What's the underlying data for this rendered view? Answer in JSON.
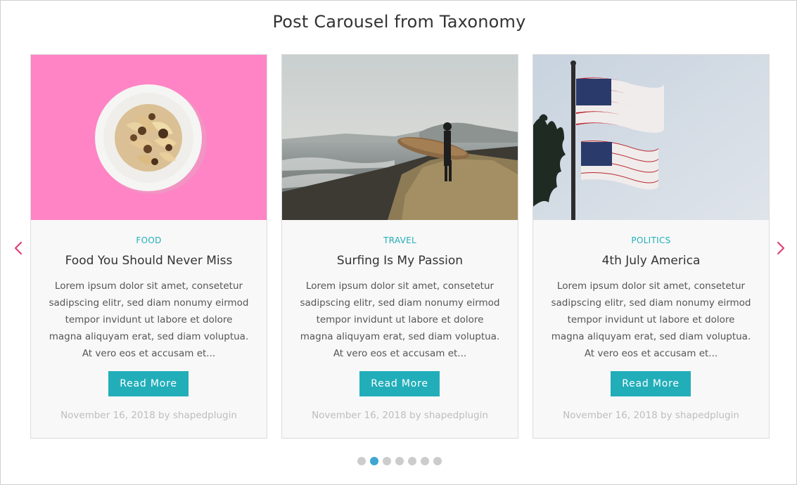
{
  "section": {
    "title": "Post Carousel from Taxonomy"
  },
  "colors": {
    "accent": "#22aeb9",
    "arrow": "#e0407a",
    "dot": "#cccccc",
    "dot_active": "#3ea6d3"
  },
  "navigation": {
    "prev_icon": "chevron-left-icon",
    "next_icon": "chevron-right-icon"
  },
  "posts": [
    {
      "category": "FOOD",
      "title": "Food You Should Never Miss",
      "excerpt": "Lorem ipsum dolor sit amet, consetetur sadipscing elitr, sed diam nonumy eirmod tempor invidunt ut labore et dolore magna aliquyam erat, sed diam voluptua. At vero eos et accusam et...",
      "button_label": "Read More",
      "date": "November 16, 2018",
      "by": "by",
      "author": "shapedplugin"
    },
    {
      "category": "TRAVEL",
      "title": "Surfing Is My Passion",
      "excerpt": "Lorem ipsum dolor sit amet, consetetur sadipscing elitr, sed diam nonumy eirmod tempor invidunt ut labore et dolore magna aliquyam erat, sed diam voluptua. At vero eos et accusam et...",
      "button_label": "Read More",
      "date": "November 16, 2018",
      "by": "by",
      "author": "shapedplugin"
    },
    {
      "category": "POLITICS",
      "title": "4th July America",
      "excerpt": "Lorem ipsum dolor sit amet, consetetur sadipscing elitr, sed diam nonumy eirmod tempor invidunt ut labore et dolore magna aliquyam erat, sed diam voluptua. At vero eos et accusam et...",
      "button_label": "Read More",
      "date": "November 16, 2018",
      "by": "by",
      "author": "shapedplugin"
    }
  ],
  "pagination": {
    "count": 7,
    "active_index": 1
  }
}
